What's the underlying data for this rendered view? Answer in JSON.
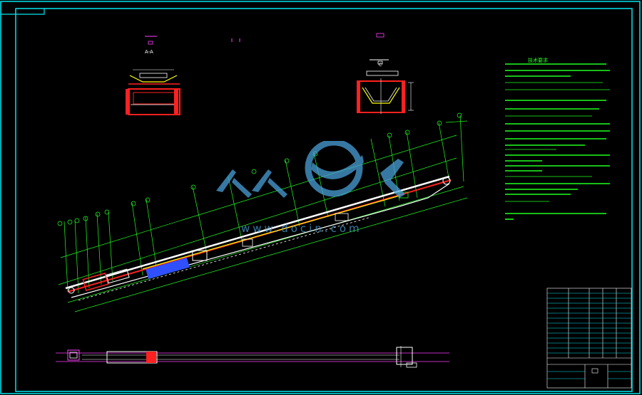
{
  "drawing": {
    "view_label_left": "A-A",
    "view_label_right": "C",
    "notes_title": "技术要求"
  },
  "watermark": {
    "text": "www.docin.com"
  },
  "colors": {
    "frame": "#00e5f0",
    "red": "#ff2020",
    "green": "#20ff20",
    "yellow": "#ffff00",
    "white": "#ffffff",
    "magenta": "#ff40ff",
    "blue": "#3050ff",
    "watermark": "#4aa0d8"
  }
}
